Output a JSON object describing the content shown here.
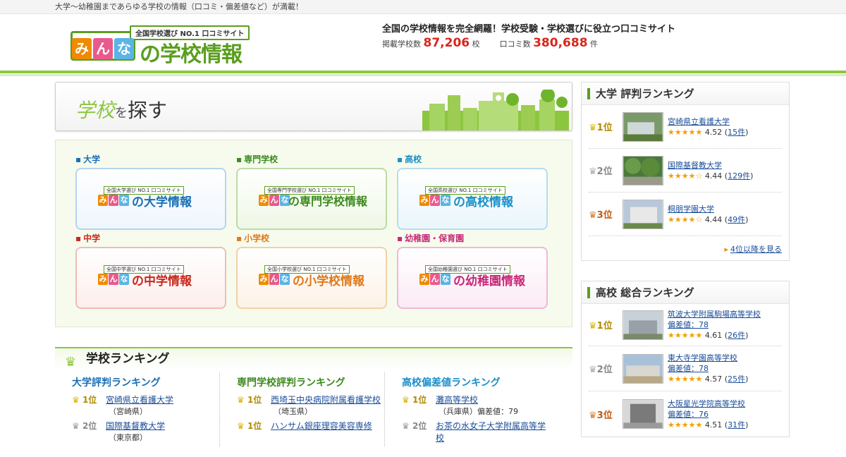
{
  "topbar": {
    "text": "大学～幼稚園まであらゆる学校の情報（口コミ・偏差値など）が満載！"
  },
  "logo": {
    "tagline": "全国学校選び NO.1 口コミサイト",
    "chars": [
      "み",
      "ん",
      "な"
    ],
    "rest": "の学校情報"
  },
  "header": {
    "headline": "全国の学校情報を完全網羅！学校受験・学校選びに役立つ口コミサイト",
    "schools_label": "掲載学校数",
    "schools_count": "87,206",
    "schools_unit": "校",
    "reviews_label": "口コミ数",
    "reviews_count": "380,688",
    "reviews_unit": "件"
  },
  "search": {
    "title_a": "学校",
    "title_wo": "を",
    "title_b": "探す"
  },
  "categories": [
    {
      "label": "大学",
      "mini": "全国大学選び NO.1 口コミサイト",
      "name": "の大学情報",
      "color": "#1a6fb5",
      "border": "#b6d4ee"
    },
    {
      "label": "専門学校",
      "mini": "全国専門学校選び NO.1 口コミサイト",
      "name": "の専門学校情報",
      "color": "#3c8a1e",
      "border": "#bcdba6"
    },
    {
      "label": "高校",
      "mini": "全国高校選び NO.1 口コミサイト",
      "name": "の高校情報",
      "color": "#1a8fc8",
      "border": "#b6dcef"
    },
    {
      "label": "中学",
      "mini": "全国中学選び NO.1 口コミサイト",
      "name": "の中学情報",
      "color": "#c8281e",
      "border": "#efbcb6"
    },
    {
      "label": "小学校",
      "mini": "全国小学校選び NO.1 口コミサイト",
      "name": "の小学校情報",
      "color": "#e0781a",
      "border": "#f3d0a6"
    },
    {
      "label": "幼稚園・保育園",
      "mini": "全国幼稚園選び NO.1 口コミサイト",
      "name": "の幼稚園情報",
      "color": "#c82878",
      "border": "#efb8d8"
    }
  ],
  "ranking": {
    "title": "学校ランキング",
    "cols": [
      {
        "title": "大学評判ランキング",
        "items": [
          {
            "rank": "1位",
            "name": "宮崎県立看護大学",
            "sub": "（宮崎県）"
          },
          {
            "rank": "2位",
            "name": "国際基督教大学",
            "sub": "（東京都）"
          }
        ]
      },
      {
        "title": "専門学校評判ランキング",
        "items": [
          {
            "rank": "1位",
            "name": "西埼玉中央病院附属看護学校",
            "sub": "（埼玉県）"
          },
          {
            "rank": "1位",
            "name": "ハンサム銀座理容美容専修",
            "sub": ""
          }
        ]
      },
      {
        "title": "高校偏差値ランキング",
        "items": [
          {
            "rank": "1位",
            "name": "灘高等学校",
            "sub": "（兵庫県）偏差値：79"
          },
          {
            "rank": "2位",
            "name": "お茶の水女子大学附属高等学校",
            "sub": ""
          }
        ]
      }
    ]
  },
  "side_univ": {
    "title": "大学 評判ランキング",
    "items": [
      {
        "rank": "1位",
        "name": "宮崎県立看護大学",
        "stars": "★★★★★",
        "score": "4.52",
        "count": "15件"
      },
      {
        "rank": "2位",
        "name": "国際基督教大学",
        "stars": "★★★★☆",
        "score": "4.44",
        "count": "129件"
      },
      {
        "rank": "3位",
        "name": "桐朋学園大学",
        "stars": "★★★★☆",
        "score": "4.44",
        "count": "49件"
      }
    ],
    "more": "4位以降を見る"
  },
  "side_high": {
    "title": "高校 総合ランキング",
    "items": [
      {
        "rank": "1位",
        "name": "筑波大学附属駒場高等学校",
        "hensa": "偏差値：78",
        "stars": "★★★★★",
        "score": "4.61",
        "count": "26件"
      },
      {
        "rank": "2位",
        "name": "東大寺学園高等学校",
        "hensa": "偏差値：78",
        "stars": "★★★★★",
        "score": "4.57",
        "count": "25件"
      },
      {
        "rank": "3位",
        "name": "大阪星光学院高等学校",
        "hensa": "偏差値：76",
        "stars": "★★★★★",
        "score": "4.51",
        "count": "31件"
      }
    ]
  },
  "colors": {
    "brand_green": "#8cc63f",
    "dark_green": "#5a9e1e",
    "count_red": "#d9261c",
    "link_blue": "#1a4d99"
  }
}
